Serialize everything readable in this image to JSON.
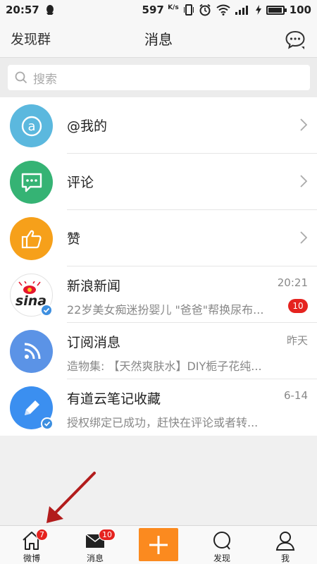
{
  "status": {
    "time": "20:57",
    "speed": "597",
    "speed_unit": "K/s",
    "battery": "100"
  },
  "header": {
    "left_label": "发现群",
    "title": "消息"
  },
  "search": {
    "placeholder": "搜索"
  },
  "system_items": [
    {
      "label": "@我的",
      "color": "#5bb8de",
      "icon": "at-icon"
    },
    {
      "label": "评论",
      "color": "#35b374",
      "icon": "comment-icon"
    },
    {
      "label": "赞",
      "color": "#f6a01a",
      "icon": "thumbs-up-icon"
    }
  ],
  "conversations": [
    {
      "name": "新浪新闻",
      "preview": "22岁美女痴迷扮婴儿 \"爸爸\"帮换尿布...",
      "time": "20:21",
      "badge": "10"
    },
    {
      "name": "订阅消息",
      "preview": "造物集: 【天然爽肤水】DIY栀子花纯...",
      "time": "昨天"
    },
    {
      "name": "有道云笔记收藏",
      "preview": "授权绑定已成功，赶快在评论或者转...",
      "time": "6-14"
    }
  ],
  "avatar_text": {
    "sina": "sina"
  },
  "tabs": [
    {
      "label": "微博",
      "badge": "7"
    },
    {
      "label": "消息",
      "badge": "10"
    },
    {
      "label": "发现"
    },
    {
      "label": "我"
    }
  ]
}
